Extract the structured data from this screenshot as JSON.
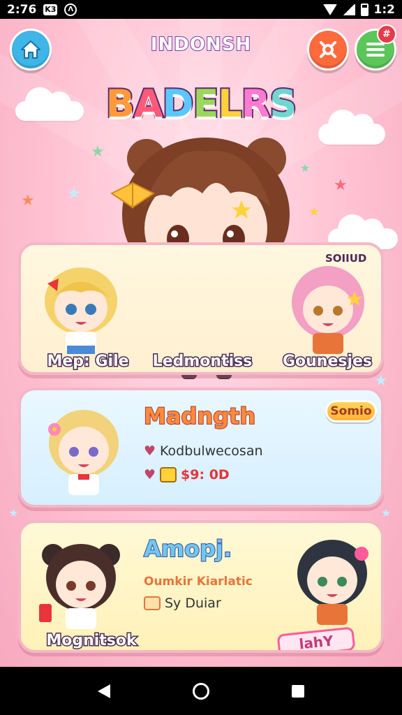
{
  "status_bar": {
    "time": "2:76",
    "icon_square": "K3",
    "icon_round": "Λ",
    "right_text": "1:2"
  },
  "header": {
    "title": "INDONSH",
    "logo_text": "BADELRS",
    "logo_colors": [
      "#ff9a3a",
      "#ff5a7a",
      "#5ac8ff",
      "#9ad85a",
      "#ffd23a",
      "#ff7ad0",
      "#6fd6d0"
    ],
    "badge_text": "#"
  },
  "cards": {
    "top": {
      "tag": "SOIIUD",
      "left_label": "Mep: Gile",
      "center_label": "Ledmontiss",
      "right_label": "Gounesjes"
    },
    "middle": {
      "title": "Madngth",
      "pill": "Somio",
      "line1": "Kodbulwecosan",
      "price": "$9: 0D"
    },
    "bottom": {
      "title": "Amopj.",
      "subtitle": "Oumkir Kiarlatic",
      "line": "Sy Duiar",
      "left_label": "Mognitsok",
      "stamp": "lahY"
    }
  },
  "colors": {
    "accent_pink": "#f7a9c0",
    "home_button": "#3fb5e8",
    "gear_button": "#ff6a3d",
    "menu_button": "#5cc65a"
  }
}
